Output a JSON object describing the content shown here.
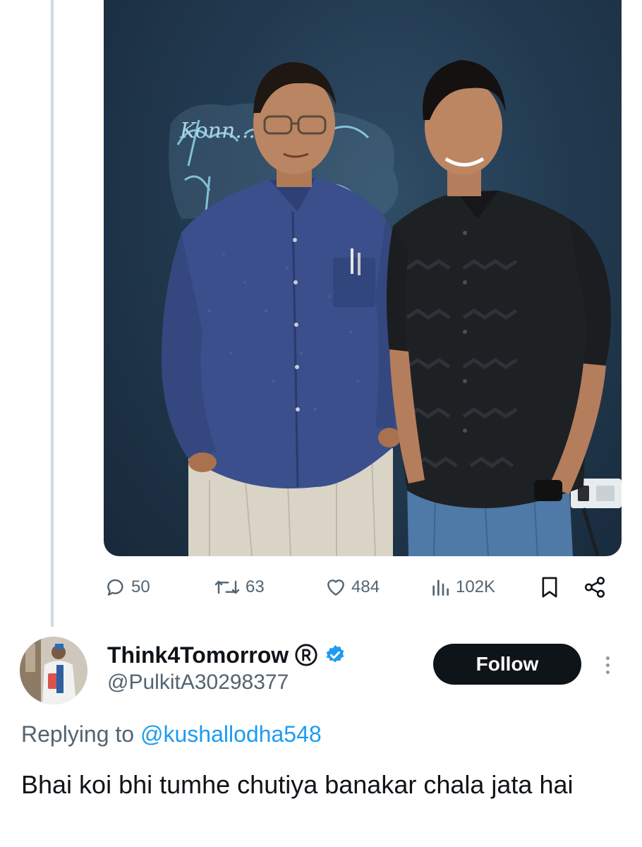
{
  "media": {
    "neon_sign": "Konn... on"
  },
  "actions": {
    "replies": "50",
    "reposts": "63",
    "likes": "484",
    "views": "102K"
  },
  "reply": {
    "display_name": "Think4Tomorrow",
    "handle": "@PulkitA30298377",
    "follow_label": "Follow",
    "replying_prefix": "Replying to",
    "replying_handle": "@kushallodha548",
    "text": "Bhai koi bhi tumhe chutiya banakar chala jata hai"
  },
  "colors": {
    "accent": "#1d9bf0",
    "muted": "#536471",
    "follow_bg": "#0f1419"
  },
  "icons": [
    "reply-icon",
    "repost-icon",
    "like-icon",
    "views-icon",
    "bookmark-icon",
    "share-icon",
    "registered-icon",
    "verified-badge-icon",
    "more-icon"
  ]
}
